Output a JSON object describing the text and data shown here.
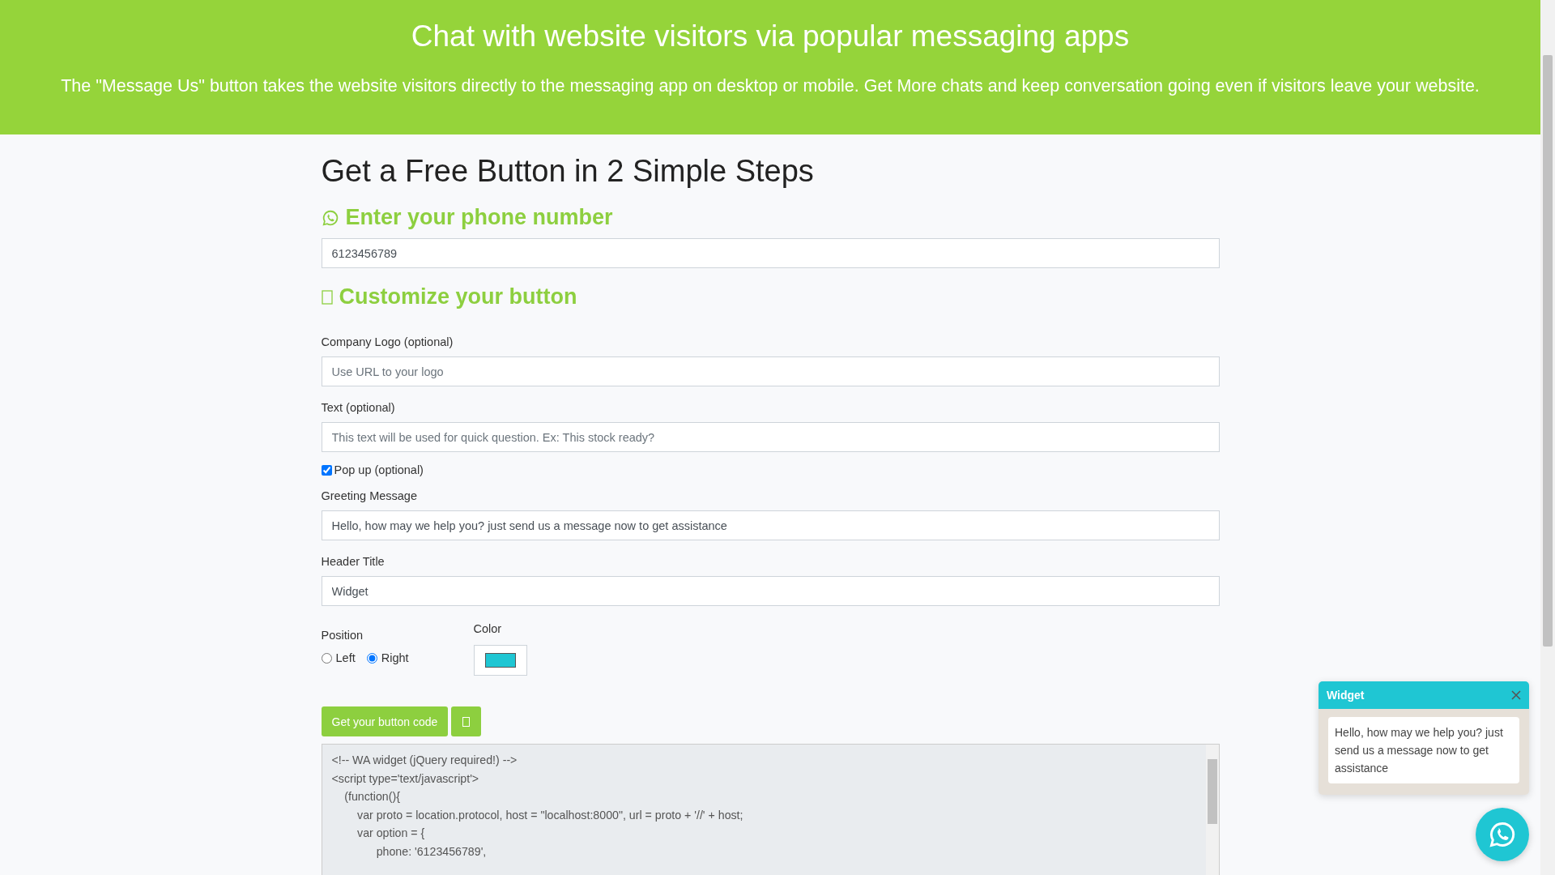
{
  "banner": {
    "title": "Chat with website visitors via popular messaging apps",
    "subtitle": "The \"Message Us\" button takes the website visitors directly to the messaging app on desktop or mobile. Get More chats and keep conversation going even if visitors leave your website."
  },
  "heading": "Get a Free Button in 2 Simple Steps",
  "phone_section": {
    "title": "Enter your phone number",
    "phone_field": {
      "value": "6123456789"
    }
  },
  "customize_section": {
    "title": "Customize your button",
    "fields": [
      {
        "kind": "text",
        "label": "Company Logo (optional)",
        "placeholder": "Use URL to your logo"
      },
      {
        "kind": "text",
        "label": "Text (optional)",
        "placeholder": "This text will be used for quick question. Ex: This stock ready?"
      },
      {
        "kind": "checkbox",
        "label": "Pop up (optional)",
        "checked": true
      },
      {
        "kind": "text",
        "label": "Greeting Message",
        "value": "Hello, how may we help you? just send us a message now to get assistance"
      },
      {
        "kind": "text",
        "label": "Header Title",
        "value": "Widget"
      }
    ]
  },
  "position": {
    "label": "Position",
    "options": [
      {
        "label": "Left",
        "selected": false
      },
      {
        "label": "Right",
        "selected": true
      }
    ]
  },
  "color_picker": {
    "label": "Color",
    "color": "#1fc6d3"
  },
  "actions": {
    "code_button": "Get your button code"
  },
  "code_lines": [
    "<!-- WA widget (jQuery required!) -->",
    "<script type='text/javascript'>",
    "    (function(){",
    "        var proto = location.protocol, host = \"localhost:8000\", url = proto + '//' + host;",
    "        var option = {",
    "              phone: '6123456789',"
  ],
  "widget_preview": {
    "title": "Widget",
    "message": "Hello, how may we help you? just send us a message now to get assistance"
  }
}
